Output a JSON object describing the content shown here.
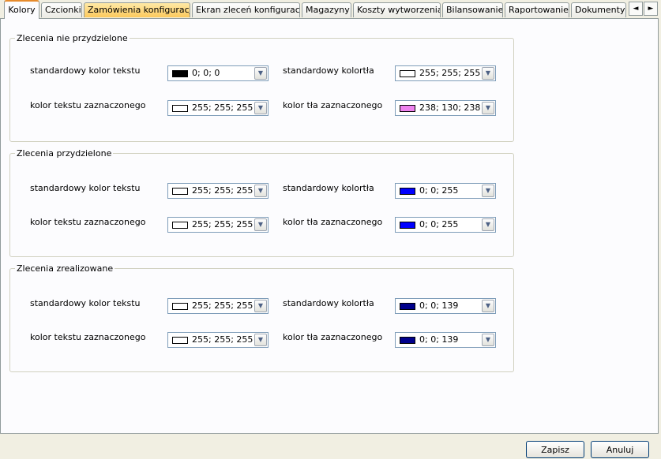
{
  "tabs": [
    {
      "label": "Kolory",
      "state": "active"
    },
    {
      "label": "Czcionki",
      "state": "normal"
    },
    {
      "label": "Zamówienia konfiguracja",
      "state": "highlighted"
    },
    {
      "label": "Ekran zleceń konfiguracja",
      "state": "normal"
    },
    {
      "label": "Magazyny",
      "state": "normal"
    },
    {
      "label": "Koszty wytworzenia",
      "state": "normal"
    },
    {
      "label": "Bilansowanie",
      "state": "normal"
    },
    {
      "label": "Raportowanie",
      "state": "normal"
    },
    {
      "label": "Dokumenty",
      "state": "normal"
    }
  ],
  "tab_scroll": {
    "left_icon": "◄",
    "right_icon": "►"
  },
  "groups": [
    {
      "title": "Zlecenia nie przydzielone",
      "fields": [
        {
          "label": "standardowy kolor tekstu",
          "value": "0; 0; 0",
          "swatch": "#000000"
        },
        {
          "label": "standardowy kolortła",
          "value": "255; 255; 255",
          "swatch": "#ffffff"
        },
        {
          "label": "kolor tekstu zaznaczonego",
          "value": "255; 255; 255",
          "swatch": "#ffffff"
        },
        {
          "label": "kolor tła zaznaczonego",
          "value": "238; 130; 238",
          "swatch": "#ee82ee"
        }
      ]
    },
    {
      "title": "Zlecenia przydzielone",
      "fields": [
        {
          "label": "standardowy kolor tekstu",
          "value": "255; 255; 255",
          "swatch": "#ffffff"
        },
        {
          "label": "standardowy kolortła",
          "value": "0; 0; 255",
          "swatch": "#0000ff"
        },
        {
          "label": "kolor tekstu zaznaczonego",
          "value": "255; 255; 255",
          "swatch": "#ffffff"
        },
        {
          "label": "kolor tła zaznaczonego",
          "value": "0; 0; 255",
          "swatch": "#0000ff"
        }
      ]
    },
    {
      "title": "Zlecenia zrealizowane",
      "fields": [
        {
          "label": "standardowy kolor tekstu",
          "value": "255; 255; 255",
          "swatch": "#ffffff"
        },
        {
          "label": "standardowy kolortła",
          "value": "0; 0; 139",
          "swatch": "#00008b"
        },
        {
          "label": "kolor tekstu zaznaczonego",
          "value": "255; 255; 255",
          "swatch": "#ffffff"
        },
        {
          "label": "kolor tła zaznaczonego",
          "value": "0; 0; 139",
          "swatch": "#00008b"
        }
      ]
    }
  ],
  "icons": {
    "dropdown": "chevron-down-icon"
  },
  "buttons": {
    "save": "Zapisz",
    "cancel": "Anuluj"
  }
}
